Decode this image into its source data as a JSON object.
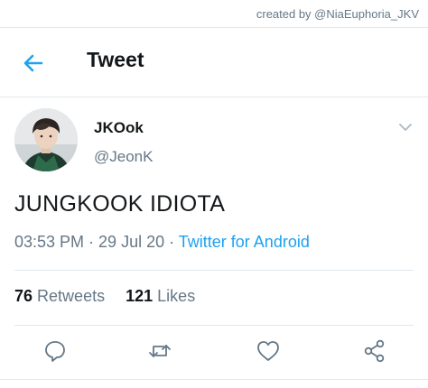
{
  "credit": "created by @NiaEuphoria_JKV",
  "header": {
    "title": "Tweet",
    "back_icon": "arrow-left-icon"
  },
  "author": {
    "display_name": "JKOok",
    "handle": "@JeonK",
    "avatar": "profile-photo",
    "menu_icon": "chevron-down-icon"
  },
  "tweet": {
    "text": "JUNGKOOK IDIOTA",
    "time": "03:53 PM",
    "sep1": " · ",
    "date": "29 Jul 20",
    "sep2": " · ",
    "source": "Twitter for Android"
  },
  "stats": {
    "retweets_count": "76",
    "retweets_label": "Retweets",
    "likes_count": "121",
    "likes_label": "Likes"
  },
  "actions": {
    "reply_icon": "reply-icon",
    "retweet_icon": "retweet-icon",
    "like_icon": "heart-icon",
    "share_icon": "share-icon"
  },
  "colors": {
    "accent": "#1da1f2",
    "text": "#14171a",
    "muted": "#657786",
    "divider": "#e1e8ed"
  }
}
